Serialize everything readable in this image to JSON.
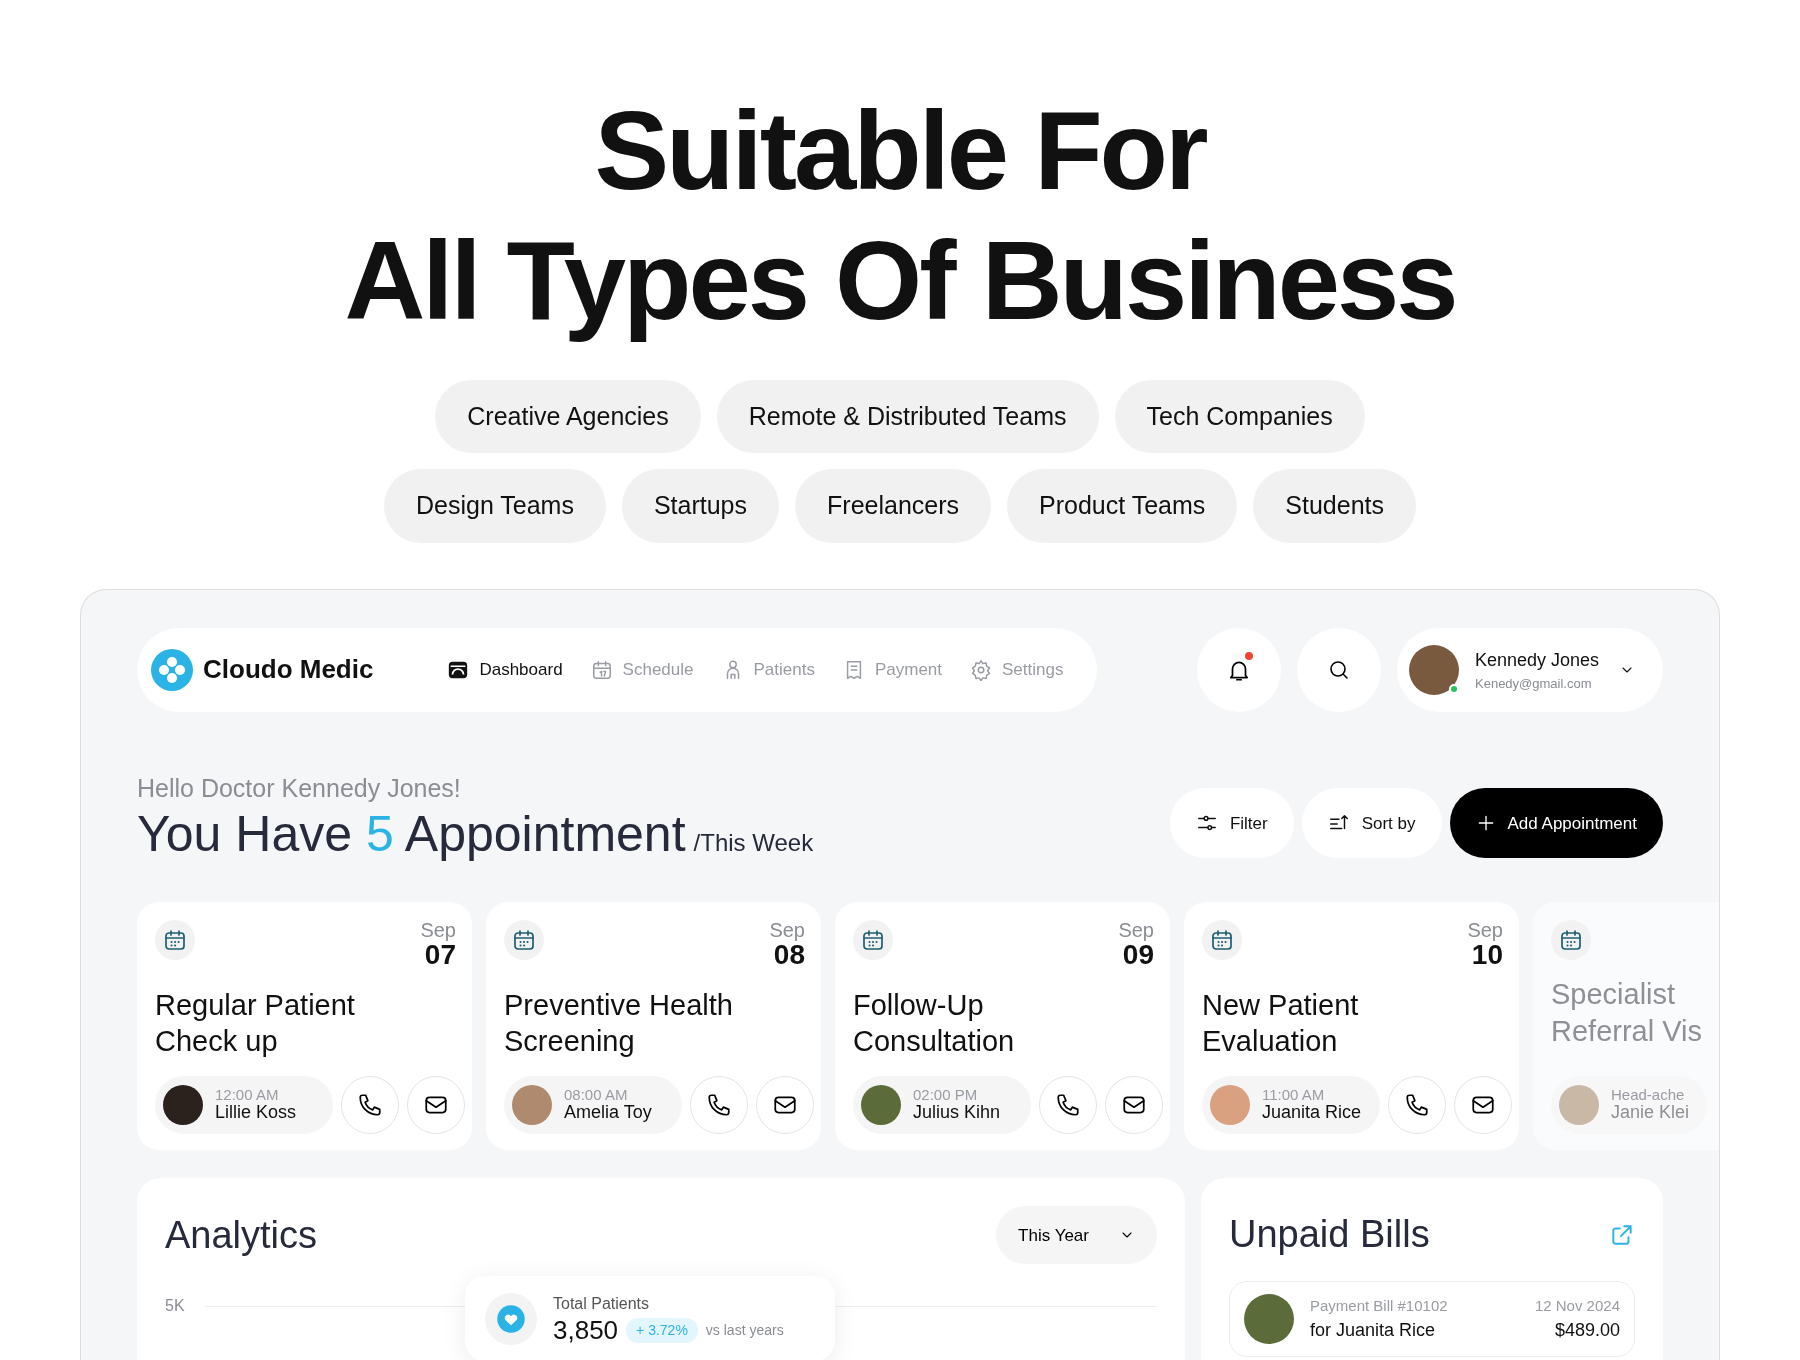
{
  "hero": {
    "title_lines": [
      "Suitable For",
      "All Types Of Business"
    ],
    "tag_rows": [
      [
        "Creative Agencies",
        "Remote & Distributed Teams",
        "Tech Companies"
      ],
      [
        "Design Teams",
        "Startups",
        "Freelancers",
        "Product Teams",
        "Students"
      ]
    ]
  },
  "navbar": {
    "brand": "Cloudo Medic",
    "items": [
      {
        "label": "Dashboard",
        "selected": true
      },
      {
        "label": "Schedule",
        "selected": false
      },
      {
        "label": "Patients",
        "selected": false
      },
      {
        "label": "Payment",
        "selected": false
      },
      {
        "label": "Settings",
        "selected": false
      }
    ],
    "notification_unread": true,
    "user": {
      "name": "Kennedy Jones",
      "email": "Kenedy@gmail.com",
      "online": true
    }
  },
  "greeting": {
    "hello": "Hello Doctor Kennedy Jones!",
    "before": "You Have",
    "count": "5",
    "after": "Appointment",
    "period": "/This Week"
  },
  "actions": [
    {
      "label": "Filter",
      "kind": "light"
    },
    {
      "label": "Sort by",
      "kind": "light"
    },
    {
      "label": "Add Appointment",
      "kind": "primary"
    }
  ],
  "appointments": [
    {
      "month": "Sep",
      "day": "07",
      "title": "Regular Patient Check up",
      "subtitle": "12:00 AM",
      "patient": "Lillie Koss"
    },
    {
      "month": "Sep",
      "day": "08",
      "title": "Preventive Health Screening",
      "subtitle": "08:00 AM",
      "patient": "Amelia Toy"
    },
    {
      "month": "Sep",
      "day": "09",
      "title": "Follow-Up Consultation",
      "subtitle": "02:00 PM",
      "patient": "Julius Kihn"
    },
    {
      "month": "Sep",
      "day": "10",
      "title": "New Patient Evaluation",
      "subtitle": "11:00 AM",
      "patient": "Juanita Rice"
    },
    {
      "title": "Specialist Referral Vis",
      "subtitle": "Head-ache",
      "patient": "Janie Klei"
    }
  ],
  "analytics": {
    "title": "Analytics",
    "period": "This Year",
    "y_tick": "5K",
    "summary": {
      "label": "Total Patients",
      "value": "3,850",
      "change": "+ 3.72%",
      "comparison": "vs last years"
    }
  },
  "unpaid_bills": {
    "title": "Unpaid Bills",
    "bills": [
      {
        "label": "Payment Bill #10102",
        "patient": "for Juanita Rice",
        "date": "12 Nov 2024",
        "amount": "$489.00"
      }
    ]
  }
}
